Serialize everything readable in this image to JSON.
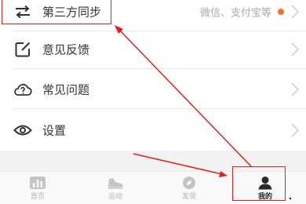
{
  "menu": {
    "items": [
      {
        "label": "第三方同步",
        "hint": "微信、支付宝等",
        "icon": "sync-lines-icon"
      },
      {
        "label": "意见反馈",
        "hint": "",
        "icon": "edit-square-icon"
      },
      {
        "label": "常见问题",
        "hint": "",
        "icon": "cloud-question-icon"
      },
      {
        "label": "设置",
        "hint": "",
        "icon": "eye-settings-icon"
      }
    ]
  },
  "tabbar": {
    "tabs": [
      {
        "label": "首页",
        "icon": "home-chart-icon",
        "active": false
      },
      {
        "label": "运动",
        "icon": "shoe-icon",
        "active": false
      },
      {
        "label": "发现",
        "icon": "compass-icon",
        "active": false
      },
      {
        "label": "我的",
        "icon": "user-icon",
        "active": true
      }
    ]
  },
  "colors": {
    "accent": "#f07030",
    "annotation": "#e02020",
    "text": "#333333",
    "hint": "#a8a8a8",
    "tab_inactive": "#b5b5b5",
    "tab_active": "#222222"
  }
}
